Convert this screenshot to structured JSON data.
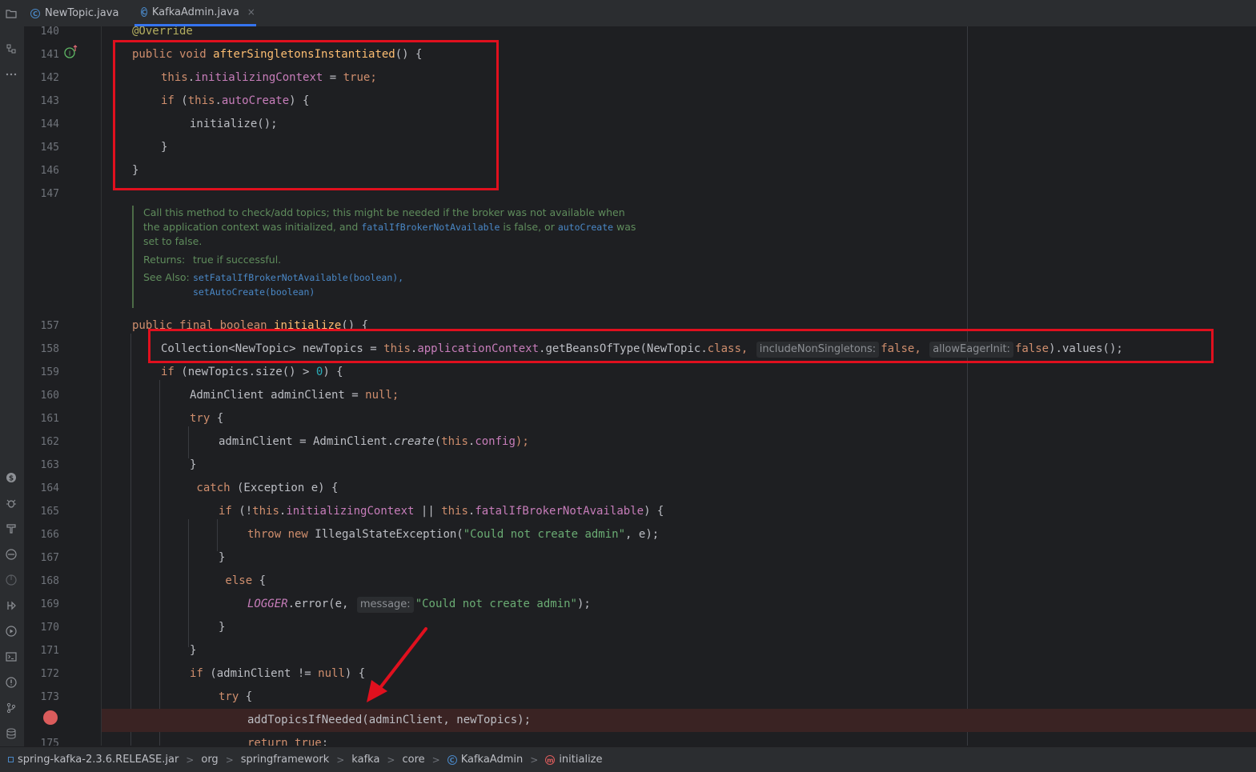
{
  "tabs": [
    {
      "label": "NewTopic.java",
      "icon": "class-icon",
      "active": false
    },
    {
      "label": "KafkaAdmin.java",
      "icon": "class-icon",
      "active": true,
      "close": "×"
    }
  ],
  "code": {
    "l140": {
      "num": "140",
      "annotation": "@Override"
    },
    "l141": {
      "num": "141",
      "t1": "public void ",
      "t2": "afterSingletonsInstantiated",
      "t3": "() {"
    },
    "l142": {
      "num": "142",
      "t1": "this",
      "t2": ".",
      "t3": "initializingContext",
      "t4": " = ",
      "t5": "true",
      "t6": ";"
    },
    "l143": {
      "num": "143",
      "t1": "if",
      "t2": " (",
      "t3": "this",
      "t4": ".",
      "t5": "autoCreate",
      "t6": ") {"
    },
    "l144": {
      "num": "144",
      "t1": "initialize();"
    },
    "l145": {
      "num": "145",
      "t1": "}"
    },
    "l146": {
      "num": "146",
      "t1": "}"
    },
    "l147": {
      "num": "147"
    },
    "l157": {
      "num": "157",
      "t1": "public final boolean ",
      "t2": "initialize",
      "t3": "() {"
    },
    "l158": {
      "num": "158",
      "t1": "Collection<NewTopic> newTopics = ",
      "t2": "this",
      "t3": ".",
      "t4": "applicationContext",
      "t5": ".getBeansOfType(NewTopic.",
      "t6": "class",
      "t7": ", ",
      "h1": "includeNonSingletons:",
      "t8": "false",
      "t9": ", ",
      "h2": "allowEagerInit:",
      "t10": "false",
      "t11": ").values();"
    },
    "l159": {
      "num": "159",
      "t1": "if",
      "t2": " (newTopics.size() > ",
      "t3": "0",
      "t4": ") {"
    },
    "l160": {
      "num": "160",
      "t1": "AdminClient adminClient = ",
      "t2": "null",
      "t3": ";"
    },
    "l161": {
      "num": "161",
      "t1": "try",
      "t2": " {"
    },
    "l162": {
      "num": "162",
      "t1": "adminClient = AdminClient.",
      "t2": "create",
      "t3": "(",
      "t4": "this",
      "t5": ".",
      "t6": "config",
      "t7": ");"
    },
    "l163": {
      "num": "163",
      "t1": "}"
    },
    "l164": {
      "num": "164",
      "t1": " catch",
      "t2": " (Exception e) {"
    },
    "l165": {
      "num": "165",
      "t1": "if",
      "t2": " (!",
      "t3": "this",
      "t4": ".",
      "t5": "initializingContext",
      "t6": " || ",
      "t7": "this",
      "t8": ".",
      "t9": "fatalIfBrokerNotAvailable",
      "t10": ") {"
    },
    "l166": {
      "num": "166",
      "t1": "throw new ",
      "t2": "IllegalStateException(",
      "t3": "\"Could not create admin\"",
      "t4": ", e);"
    },
    "l167": {
      "num": "167",
      "t1": "}"
    },
    "l168": {
      "num": "168",
      "t1": " else",
      "t2": " {"
    },
    "l169": {
      "num": "169",
      "t1": "LOGGER",
      "t2": ".error(e, ",
      "h1": "message:",
      "t3": "\"Could not create admin\"",
      "t4": ");"
    },
    "l170": {
      "num": "170",
      "t1": "}"
    },
    "l171": {
      "num": "171",
      "t1": "}"
    },
    "l172": {
      "num": "172",
      "t1": "if",
      "t2": " (adminClient != ",
      "t3": "null",
      "t4": ") {"
    },
    "l173": {
      "num": "173",
      "t1": "try",
      "t2": " {"
    },
    "l174": {
      "t1": "addTopicsIfNeeded(adminClient, newTopics);"
    },
    "l175": {
      "num": "175",
      "t1": "return true",
      "t2": ";"
    }
  },
  "doc": {
    "line1": "Call this method to check/add topics; this might be needed if the broker was not available when",
    "line2a": "the application context was initialized, and ",
    "code1": "fatalIfBrokerNotAvailable",
    "line2b": " is false, or ",
    "code2": "autoCreate",
    "line2c": " was",
    "line3": "set to false.",
    "returns_label": "Returns:",
    "returns_text": "true if successful.",
    "seealso_label": "See Also:",
    "seealso1": "setFatalIfBrokerNotAvailable(boolean),",
    "seealso2": "setAutoCreate(boolean)"
  },
  "breadcrumbs": [
    "spring-kafka-2.3.6.RELEASE.jar",
    "org",
    "springframework",
    "kafka",
    "core",
    "KafkaAdmin",
    "initialize"
  ],
  "colors": {
    "accent": "#3574f0",
    "annotation_red": "#e0101e",
    "breakpoint": "#db5c5c"
  }
}
